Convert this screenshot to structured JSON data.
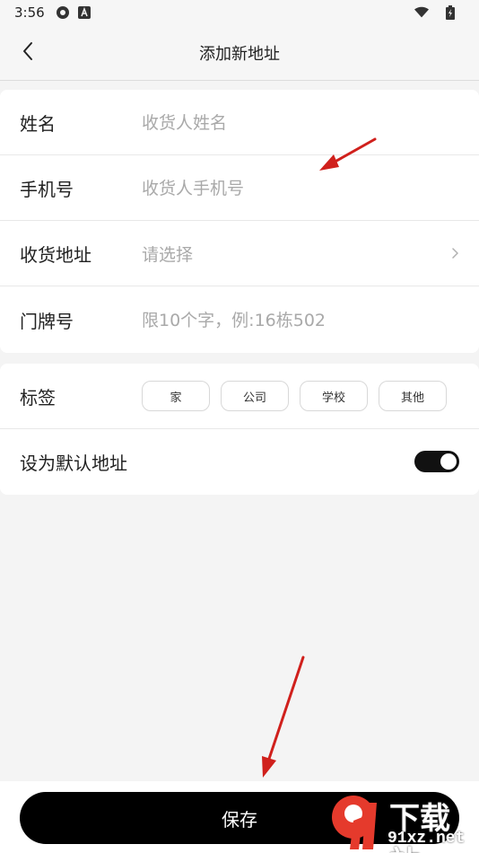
{
  "status_bar": {
    "time": "3:56",
    "icons": [
      "settings-gear-icon",
      "a-box-icon",
      "wifi-icon",
      "battery-icon"
    ]
  },
  "nav": {
    "title": "添加新地址",
    "back_icon": "chevron-left-icon"
  },
  "form": {
    "name": {
      "label": "姓名",
      "placeholder": "收货人姓名"
    },
    "phone": {
      "label": "手机号",
      "placeholder": "收货人手机号"
    },
    "address": {
      "label": "收货地址",
      "placeholder": "请选择",
      "icon": "chevron-right-icon"
    },
    "door": {
      "label": "门牌号",
      "placeholder": "限10个字，例:16栋502"
    }
  },
  "tags": {
    "label": "标签",
    "options": [
      "家",
      "公司",
      "学校",
      "其他"
    ]
  },
  "default": {
    "label": "设为默认地址",
    "toggle_on": true
  },
  "save": {
    "label": "保存"
  },
  "watermark": {
    "text": "下载站",
    "domain": "91xz.net"
  },
  "colors": {
    "background": "#f4f4f4",
    "primary": "#000000",
    "placeholder": "#a9a9a9",
    "annotation_arrow": "#d0201c"
  }
}
